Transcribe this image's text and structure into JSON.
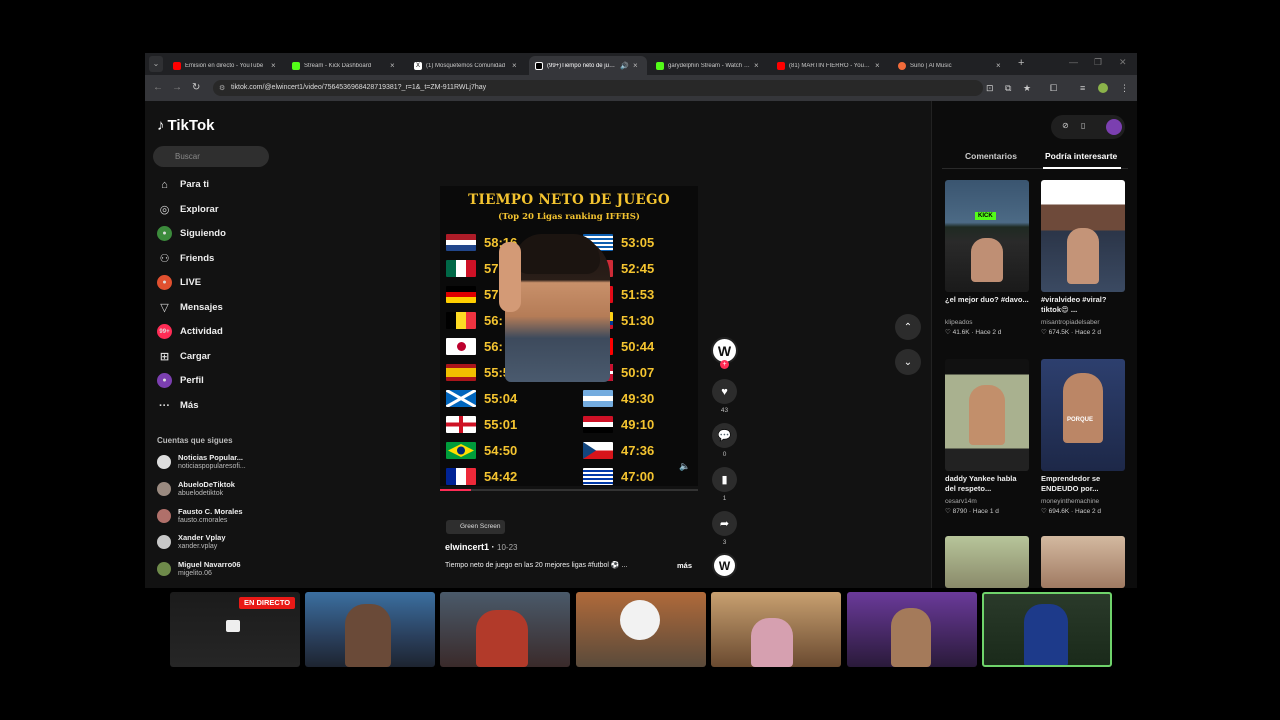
{
  "browser": {
    "tabs": [
      {
        "title": "Emisión en directo - YouTube",
        "color": "#ff0000"
      },
      {
        "title": "Stream - Kick Dashboard",
        "color": "#53fc18"
      },
      {
        "title": "(1) Mosquetemos Comunidad",
        "color": "#ffffff"
      },
      {
        "title": "(99+)Tiempo neto de juego",
        "color": "#ffffff"
      },
      {
        "title": "garydelphin Stream - Watch Live",
        "color": "#53fc18"
      },
      {
        "title": "(81) MARTIN FIERRO - YouTube",
        "color": "#ff0000"
      },
      {
        "title": "Suno | AI Music",
        "color": "#f26b3a"
      }
    ],
    "active_tab": 3,
    "url": "tiktok.com/@elwincert1/video/7564536968428719381?_r=1&_t=ZM-911RWLj7hay"
  },
  "tiktok": {
    "logo": "TikTok",
    "search_placeholder": "Buscar",
    "nav": [
      {
        "label": "Para ti",
        "icon": "home-icon"
      },
      {
        "label": "Explorar",
        "icon": "compass-icon"
      },
      {
        "label": "Siguiendo",
        "icon": "following-icon"
      },
      {
        "label": "Friends",
        "icon": "friends-icon"
      },
      {
        "label": "LIVE",
        "icon": "live-icon"
      },
      {
        "label": "Mensajes",
        "icon": "messages-icon"
      },
      {
        "label": "Actividad",
        "icon": "activity-icon"
      },
      {
        "label": "Cargar",
        "icon": "upload-icon"
      },
      {
        "label": "Perfil",
        "icon": "profile-icon"
      },
      {
        "label": "Más",
        "icon": "more-icon"
      }
    ],
    "following_heading": "Cuentas que sigues",
    "following": [
      {
        "name": "Noticias Popular...",
        "handle": "noticiaspopularesofi..."
      },
      {
        "name": "AbueloDeTiktok",
        "handle": "abuelodetiktok"
      },
      {
        "name": "Fausto C. Morales",
        "handle": "fausto.cmorales"
      },
      {
        "name": "Xander Vplay",
        "handle": "xander.vplay"
      },
      {
        "name": "Miguel Navarro06",
        "handle": "migelito.06"
      }
    ]
  },
  "video": {
    "title": "TIEMPO NETO DE JUEGO",
    "subtitle": "(Top 20 Ligas ranking IFFHS)",
    "left_times": [
      "58:16",
      "57:50",
      "57:",
      "56:",
      "56:",
      "55:5",
      "55:04",
      "55:01",
      "54:50",
      "54:42"
    ],
    "right_times": [
      "53:05",
      "52:45",
      "51:53",
      "51:30",
      "50:44",
      "50:07",
      "49:30",
      "49:10",
      "47:36",
      "47:00"
    ],
    "progress": 0.12,
    "tag": "Green Screen",
    "author": "elwincert1",
    "date": "10-23",
    "caption": "Tiempo neto de juego en las 20 mejores ligas #futbol ⚽ ...",
    "more": "más",
    "creator_initial": "W",
    "likes": "43",
    "comments": "0",
    "saves": "1",
    "shares": "3"
  },
  "right_panel": {
    "tab_comments": "Comentarios",
    "tab_suggestions": "Podría interesarte",
    "cards": [
      {
        "caption": "¿el mejor duo? #davo...",
        "user": "klipeados",
        "stats": "41.6K · Hace 2 d"
      },
      {
        "caption": "#viralvideo #viral? tiktok😍 ...",
        "user": "misantropiadelsaber",
        "stats": "674.5K · Hace 2 d"
      },
      {
        "caption": "daddy Yankee habla del respeto...",
        "user": "cesarv14m",
        "stats": "8790 · Hace 1 d"
      },
      {
        "caption": "Emprendedor se ENDEUDO por...",
        "user": "moneyinthemachine",
        "stats": "694.6K · Hace 2 d"
      }
    ],
    "thumb_labels": [
      "KICK",
      "PORQUE"
    ]
  },
  "stream": {
    "live_label": "EN DIRECTO"
  }
}
